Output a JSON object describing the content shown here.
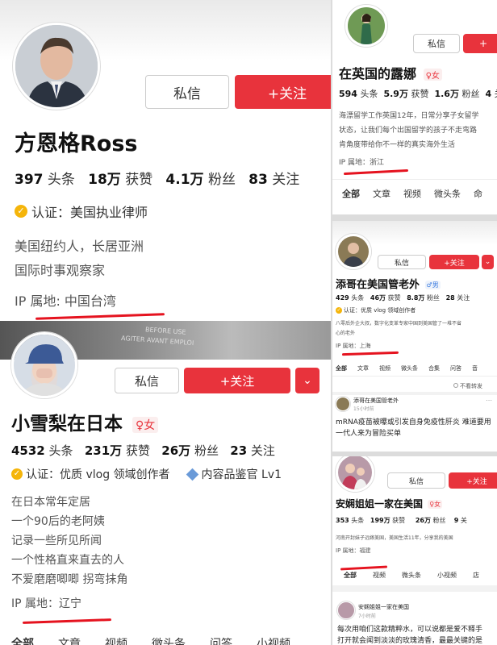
{
  "p1": {
    "dm": "私信",
    "follow": "+关注",
    "name": "方恩格Ross",
    "stats": [
      {
        "n": "397",
        "l": "头条"
      },
      {
        "n": "18万",
        "l": "获赞"
      },
      {
        "n": "4.1万",
        "l": "粉丝"
      },
      {
        "n": "83",
        "l": "关注"
      }
    ],
    "verify": "认证：美国执业律师",
    "bio": [
      "美国纽约人，长居亚洲",
      "国际时事观察家"
    ],
    "ip": "IP 属地: 中国台湾"
  },
  "p2": {
    "dm": "私信",
    "follow": "+关注",
    "more": "⌄",
    "name": "小雪梨在日本",
    "gender": "♀女",
    "stats": [
      {
        "n": "4532",
        "l": "头条"
      },
      {
        "n": "231万",
        "l": "获赞"
      },
      {
        "n": "26万",
        "l": "粉丝"
      },
      {
        "n": "23",
        "l": "关注"
      }
    ],
    "verify": "认证：优质 vlog 领域创作者",
    "badge2": "内容品鉴官 Lv1",
    "bio": [
      "在日本常年定居",
      "一个90后的老阿姨",
      "记录一些所见所闻",
      "一个性格直来直去的人",
      "不爱磨磨唧唧 拐弯抹角"
    ],
    "ip": "IP 属地：辽宁",
    "tabs": [
      "全部",
      "文章",
      "视频",
      "微头条",
      "问答",
      "小视频"
    ],
    "photo_text": [
      "BEFORE USE",
      "AGITER AVANT EMPLOI"
    ]
  },
  "p3": {
    "dm": "私信",
    "follow": "+",
    "name": "在英国的露娜",
    "gender": "♀女",
    "stats": [
      {
        "n": "594",
        "l": "头条"
      },
      {
        "n": "5.9万",
        "l": "获赞"
      },
      {
        "n": "1.6万",
        "l": "粉丝"
      },
      {
        "n": "4",
        "l": "关"
      }
    ],
    "bio": [
      "海漂留学工作英国12年，日常分享子女留学",
      "状态，让我们每个出国留学的孩子不走弯路",
      "肯角度带给你不一样的真实海外生活"
    ],
    "ip": "IP 属地：浙江",
    "tabs": [
      "全部",
      "文章",
      "视频",
      "微头条",
      "命"
    ]
  },
  "p4": {
    "dm": "私信",
    "follow": "+关注",
    "more": "⌄",
    "name": "添哥在美国管老外",
    "gender": "♂男",
    "stats": [
      {
        "n": "429",
        "l": "头条"
      },
      {
        "n": "46万",
        "l": "获赞"
      },
      {
        "n": "8.8万",
        "l": "粉丝"
      },
      {
        "n": "28",
        "l": "关注"
      }
    ],
    "verify": "认证：优质 vlog 领域创作者",
    "bio": [
      "八零后外企大叔，数字化变革专家中国到美国管了一堆不省",
      "心的老外"
    ],
    "ip": "IP 属地：上海",
    "tabs": [
      "全部",
      "文章",
      "视频",
      "微头条",
      "合集",
      "问答",
      "音"
    ],
    "notint": "不看转发",
    "post_author": "添哥在美国管老外",
    "post_time": "15小时前",
    "post_text": [
      "mRNA疫苗被曝或引发自身免疫性肝炎 难道要用",
      "一代人来为冒险买单"
    ]
  },
  "p5": {
    "dm": "私信",
    "follow": "+关注",
    "name": "安娴姐姐一家在美国",
    "gender": "♀女",
    "stats": [
      {
        "n": "353",
        "l": "头条"
      },
      {
        "n": "199万",
        "l": "获赞"
      },
      {
        "n": "26万",
        "l": "粉丝"
      },
      {
        "n": "9",
        "l": "关"
      }
    ],
    "bio": [
      "河南开封妹子远嫁美国，美国生活11年，分享我的美国"
    ],
    "ip": "IP 属地：福建",
    "tabs": [
      "全部",
      "视频",
      "微头条",
      "小视频",
      "店"
    ],
    "post_author": "安娴姐姐一家在美国",
    "post_time": "7小时前",
    "post_text": [
      "每次用咱们这款精粹水，可以说都是爱不释手",
      "打开就会闻到淡淡的玫瑰清香，最最关键的是"
    ]
  }
}
